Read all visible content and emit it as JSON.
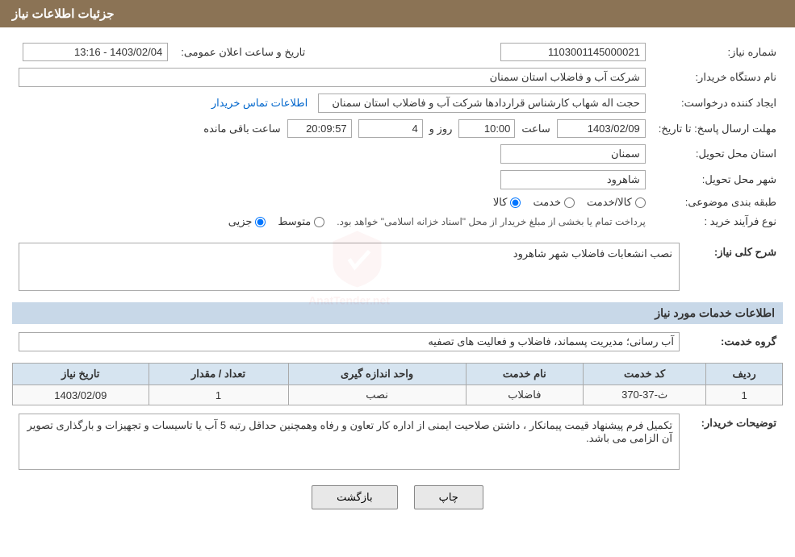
{
  "header": {
    "title": "جزئیات اطلاعات نیاز"
  },
  "fields": {
    "shomara_niaz_label": "شماره نیاز:",
    "shomara_niaz_value": "1103001145000021",
    "nam_dastgah_label": "نام دستگاه خریدار:",
    "nam_dastgah_value": "شرکت آب و فاضلاب استان سمنان",
    "ijad_konande_label": "ایجاد کننده درخواست:",
    "ijad_konande_value": "حجت اله شهاب کارشناس قراردادها شرکت آب و فاضلاب استان سمنان",
    "mohlat_label": "مهلت ارسال پاسخ: تا تاریخ:",
    "tarikh_elan_label": "تاریخ و ساعت اعلان عمومی:",
    "tarikh_elan_value": "1403/02/04 - 13:16",
    "ettelaat_link": "اطلاعات تماس خریدار",
    "deadline_date": "1403/02/09",
    "deadline_time": "10:00",
    "deadline_days": "4",
    "deadline_clock": "20:09:57",
    "deadline_remaining": "ساعت باقی مانده",
    "deadline_and": "روز و",
    "ostan_label": "استان محل تحویل:",
    "ostan_value": "سمنان",
    "shahr_label": "شهر محل تحویل:",
    "shahr_value": "شاهرود",
    "tabaqe_label": "طبقه بندی موضوعی:",
    "tabaqe_kala": "کالا",
    "tabaqe_khedmat": "خدمت",
    "tabaqe_kala_khedmat": "کالا/خدمت",
    "nooe_farayand_label": "نوع فرآیند خرید :",
    "nooe_jozi": "جزیی",
    "nooe_motovaset": "متوسط",
    "nooe_description": "پرداخت تمام یا بخشی از مبلغ خریدار از محل \"اسناد خزانه اسلامی\" خواهد بود.",
    "sharh_label": "شرح کلی نیاز:",
    "sharh_value": "نصب انشعابات فاضلاب شهر شاهرود",
    "khadamat_header": "اطلاعات خدمات مورد نیاز",
    "goroh_khedmat_label": "گروه خدمت:",
    "goroh_khedmat_value": "آب رسانی؛ مدیریت پسماند، فاضلاب و فعالیت های تصفیه",
    "table": {
      "headers": [
        "ردیف",
        "کد خدمت",
        "نام خدمت",
        "واحد اندازه گیری",
        "تعداد / مقدار",
        "تاریخ نیاز"
      ],
      "rows": [
        [
          "1",
          "ث-37-370",
          "فاضلاب",
          "نصب",
          "1",
          "1403/02/09"
        ]
      ]
    },
    "notes_label": "توضیحات خریدار:",
    "notes_value": "تکمیل فرم پیشنهاد قیمت پیمانکار ، داشتن صلاحیت ایمنی از اداره کار تعاون و رفاه وهمچنین حداقل رتبه 5 آب یا تاسیسات و تجهیزات و بارگذاری تصویر آن الزامی می باشد.",
    "btn_bazgasht": "بازگشت",
    "btn_chap": "چاپ"
  }
}
